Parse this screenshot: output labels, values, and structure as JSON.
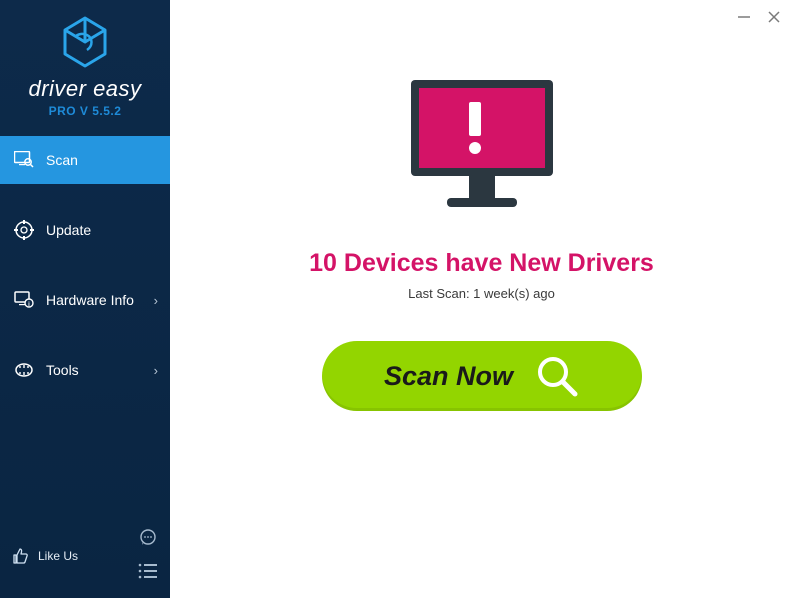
{
  "brand": {
    "name": "driver easy",
    "version": "PRO V 5.5.2"
  },
  "nav": {
    "scan": "Scan",
    "update": "Update",
    "hardware_info": "Hardware Info",
    "tools": "Tools"
  },
  "footer": {
    "like_us": "Like Us"
  },
  "main": {
    "headline": "10 Devices have New Drivers",
    "subline": "Last Scan: 1 week(s) ago",
    "scan_button": "Scan Now"
  },
  "colors": {
    "sidebar": "#0c2847",
    "active": "#2596e0",
    "accent_version": "#1e8bd8",
    "headline": "#d41367",
    "scan_button": "#93d500",
    "monitor": "#d41367"
  }
}
